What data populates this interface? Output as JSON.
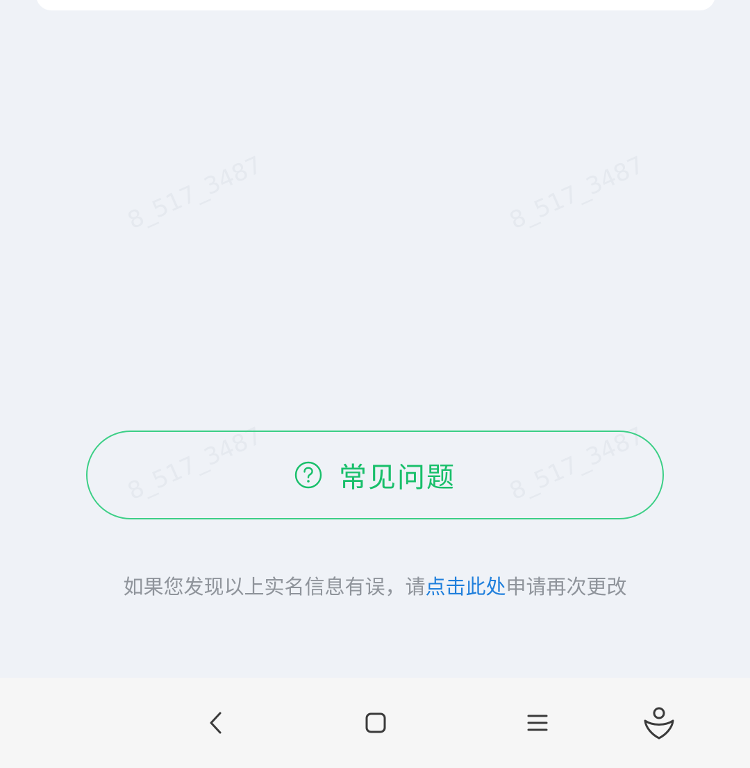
{
  "watermark": {
    "text": "8_517_3487"
  },
  "faq": {
    "label": "常见问题",
    "icon": "question-circle-icon",
    "color": "#18bf6a",
    "border_color": "#3ccf86"
  },
  "info": {
    "prefix": "如果您发现以上实名信息有误，请",
    "link": "点击此处",
    "suffix": "申请再次更改",
    "link_color": "#1f7fdc"
  },
  "nav": {
    "back_icon": "chevron-left-icon",
    "home_icon": "square-icon",
    "menu_icon": "hamburger-icon",
    "assistant_icon": "assistant-person-icon"
  }
}
